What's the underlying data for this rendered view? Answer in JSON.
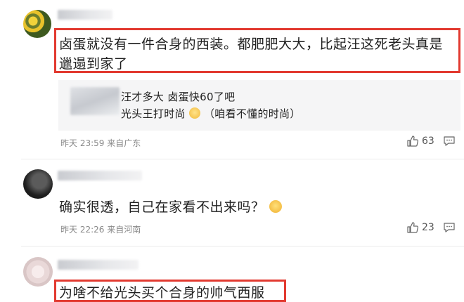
{
  "comments": [
    {
      "text_line1": "卤蛋就没有一件合身的西装。都肥肥大大，比起汪这死老头真是",
      "text_line2": "邋遢到家了",
      "reply": {
        "line1": "汪才多大 卤蛋快60了吧",
        "line2": "光头王打时尚",
        "line2_suffix": "（咱看不懂的时尚）"
      },
      "time": "昨天 23:59 来自广东",
      "likes": "63"
    },
    {
      "text": "确实很透，自己在家看不出来吗？",
      "time": "昨天 22:26 来自河南",
      "likes": "23"
    },
    {
      "text": "为啥不给光头买个合身的帅气西服"
    }
  ],
  "colors": {
    "highlight": "#e23a30",
    "meta": "#888888",
    "icon": "#666666"
  }
}
